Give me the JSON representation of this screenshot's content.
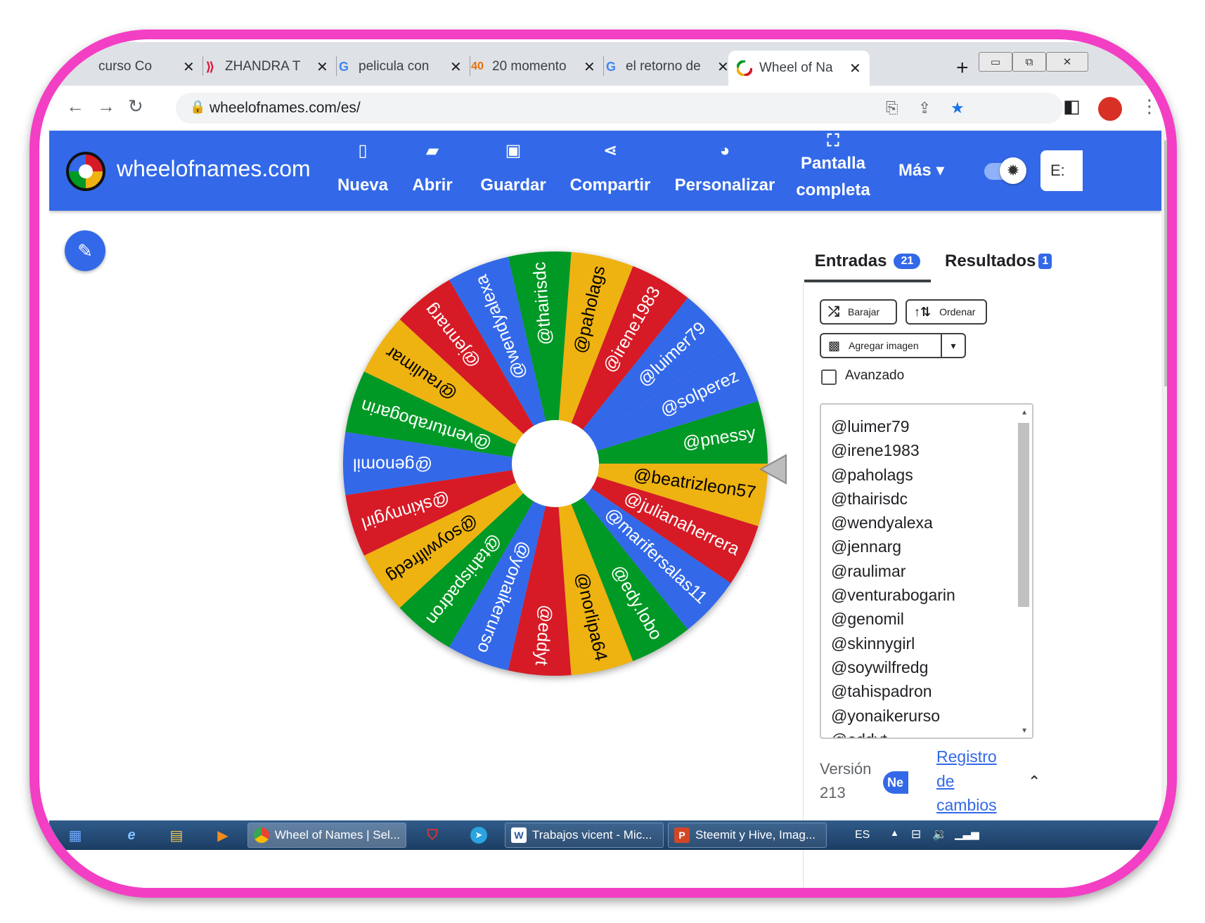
{
  "browser": {
    "tabs": [
      {
        "label": "Concurso Co",
        "visible": "curso Co",
        "icon": "hive-red-icon"
      },
      {
        "label": "ZHANDRA T",
        "icon": "hive-icon",
        "color": "#e31337"
      },
      {
        "label": "pelicula con",
        "icon": "google-icon"
      },
      {
        "label": "20 momento",
        "icon": "app-icon"
      },
      {
        "label": "el retorno de",
        "icon": "google-icon"
      },
      {
        "label": "Wheel of Na",
        "icon": "wheel-icon",
        "active": true
      }
    ],
    "close_glyph": "✕",
    "new_tab": "+",
    "tab_menu": "⌄",
    "url": "wheelofnames.com/es/"
  },
  "app": {
    "brand": "wheelofnames.com",
    "nav": {
      "nueva": "Nueva",
      "abrir": "Abrir",
      "guardar": "Guardar",
      "compartir": "Compartir",
      "personalizar": "Personalizar",
      "pantalla_1": "Pantalla",
      "pantalla_2": "completa",
      "mas": "Más ▾",
      "lang": "E:"
    },
    "accent": "#3369e8"
  },
  "wheel": {
    "colors": [
      "#3369e8",
      "#d61b26",
      "#eeb211",
      "#009925"
    ],
    "entries": [
      "@luimer79",
      "@irene1983",
      "@paholags",
      "@thairisdc",
      "@wendyalexa",
      "@jennarg",
      "@raulimar",
      "@venturabogarin",
      "@genomil",
      "@skinnygirl",
      "@soywilfredg",
      "@tahispadron",
      "@yonaikerurso",
      "@eddyt",
      "@norlipa64",
      "@edy.lobo",
      "@marifersalas11",
      "@julianaherrera",
      "@beatrizleon57",
      "@pnessy",
      "@solperez"
    ]
  },
  "panel": {
    "tab_entradas": "Entradas",
    "entradas_count": "21",
    "tab_resultados": "Resultados",
    "resultados_count": "1",
    "shuffle": "Barajar",
    "sort": "Ordenar",
    "add_image": "Agregar imagen",
    "advanced": "Avanzado",
    "version_label": "Versión",
    "version_number": "213",
    "new_badge": "Ne",
    "changelog_1": "Registro",
    "changelog_2": "de",
    "changelog_3": "cambios",
    "list_entries": [
      "@luimer79",
      "@irene1983",
      "@paholags",
      "@thairisdc",
      "@wendyalexa",
      "@jennarg",
      "@raulimar",
      "@venturabogarin",
      "@genomil",
      "@skinnygirl",
      "@soywilfredg",
      "@tahispadron",
      "@yonaikerurso",
      "@eddyt"
    ]
  },
  "taskbar": {
    "tasks": [
      {
        "label": "Wheel of Names | Sel...",
        "icon": "chrome-icon",
        "active": true
      },
      {
        "label": "Trabajos vicent - Mic...",
        "icon": "word-icon",
        "icon_text": "W"
      },
      {
        "label": "Steemit y Hive, Imag...",
        "icon": "powerpoint-icon",
        "icon_text": "P"
      }
    ],
    "lang": "ES"
  }
}
